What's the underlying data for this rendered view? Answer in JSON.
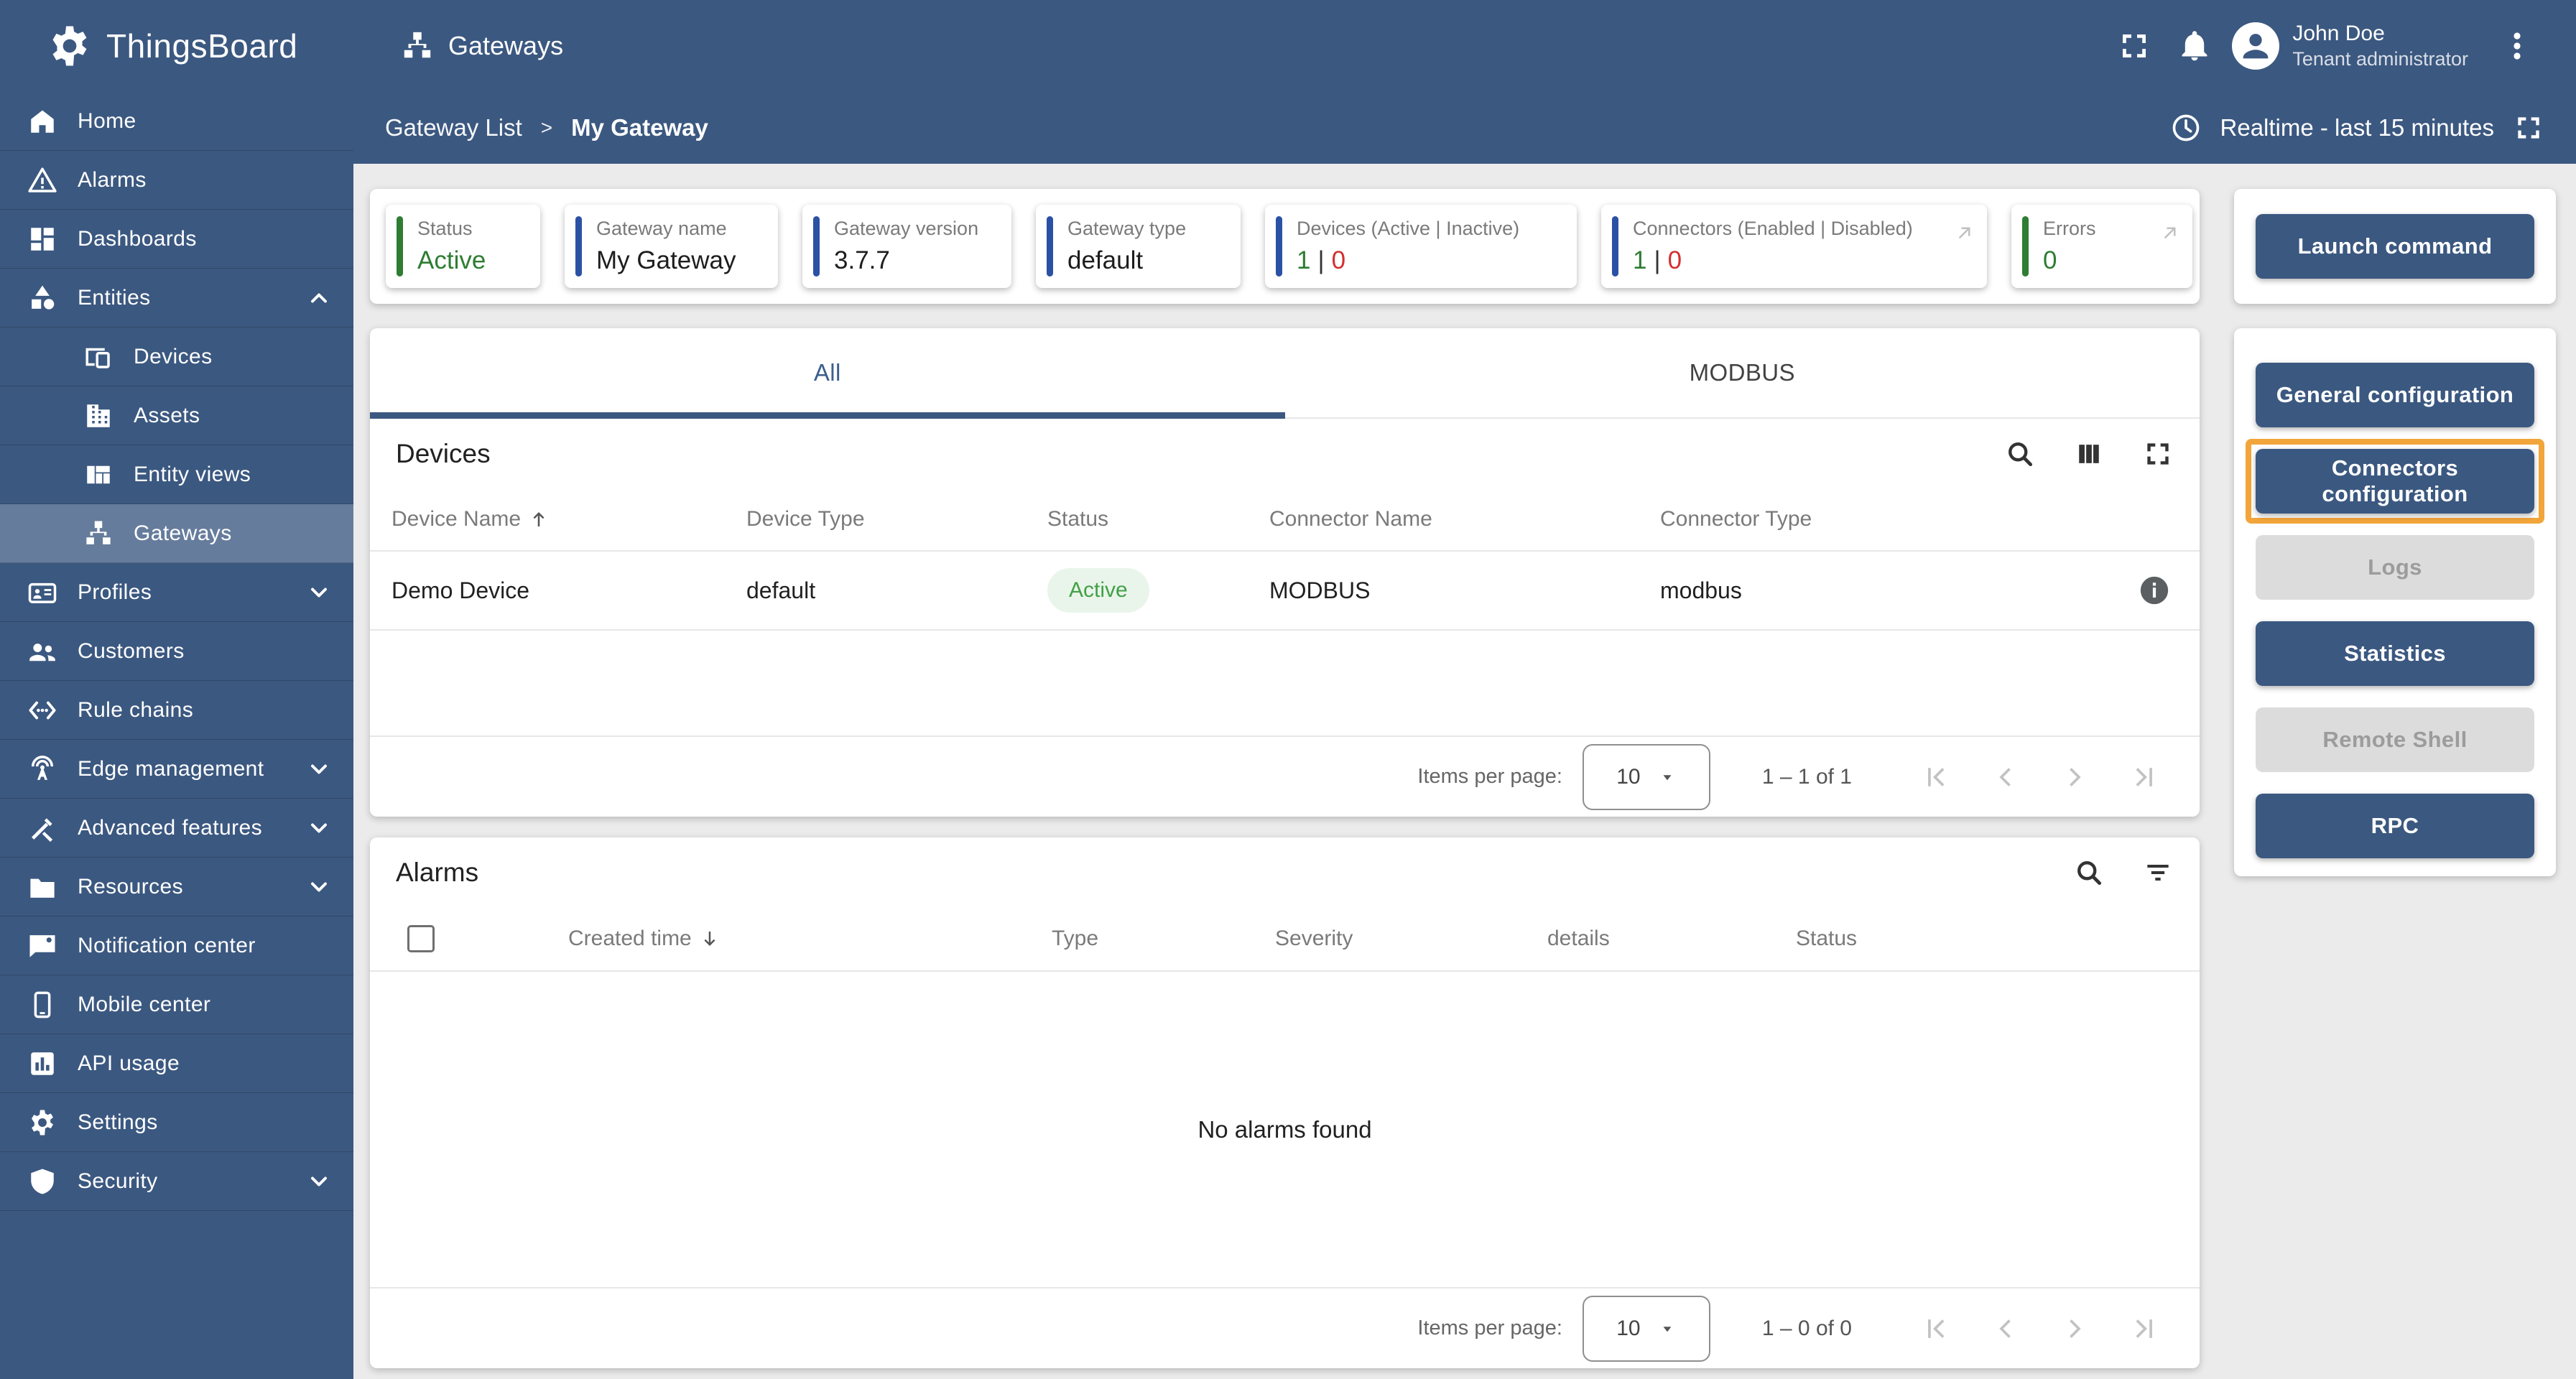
{
  "topbar": {
    "brand": "ThingsBoard",
    "page_title": "Gateways",
    "user": {
      "name": "John Doe",
      "role": "Tenant administrator"
    }
  },
  "breadcrumb": {
    "parent": "Gateway List",
    "separator": ">",
    "current": "My Gateway"
  },
  "time_window": {
    "label": "Realtime - last 15 minutes"
  },
  "sidebar": {
    "items": [
      {
        "label": "Home"
      },
      {
        "label": "Alarms"
      },
      {
        "label": "Dashboards"
      },
      {
        "label": "Entities",
        "expanded": true,
        "children": [
          {
            "label": "Devices"
          },
          {
            "label": "Assets"
          },
          {
            "label": "Entity views"
          },
          {
            "label": "Gateways",
            "selected": true
          }
        ]
      },
      {
        "label": "Profiles"
      },
      {
        "label": "Customers"
      },
      {
        "label": "Rule chains"
      },
      {
        "label": "Edge management"
      },
      {
        "label": "Advanced features"
      },
      {
        "label": "Resources"
      },
      {
        "label": "Notification center"
      },
      {
        "label": "Mobile center"
      },
      {
        "label": "API usage"
      },
      {
        "label": "Settings"
      },
      {
        "label": "Security"
      }
    ]
  },
  "stats": {
    "status": {
      "label": "Status",
      "value": "Active"
    },
    "gateway_name": {
      "label": "Gateway name",
      "value": "My Gateway"
    },
    "gateway_version": {
      "label": "Gateway version",
      "value": "3.7.7"
    },
    "gateway_type": {
      "label": "Gateway type",
      "value": "default"
    },
    "devices": {
      "label": "Devices (Active | Inactive)",
      "value_active": "1",
      "value_divider": "|",
      "value_inactive": "0"
    },
    "connectors": {
      "label": "Connectors (Enabled | Disabled)",
      "value_enabled": "1",
      "value_divider": "|",
      "value_disabled": "0"
    },
    "errors": {
      "label": "Errors",
      "value": "0"
    }
  },
  "tabs": {
    "all": "All",
    "modbus": "MODBUS"
  },
  "devices_panel": {
    "title": "Devices",
    "columns": {
      "name": "Device Name",
      "type": "Device Type",
      "status": "Status",
      "connector_name": "Connector Name",
      "connector_type": "Connector Type"
    },
    "rows": [
      {
        "name": "Demo Device",
        "type": "default",
        "status": "Active",
        "connector_name": "MODBUS",
        "connector_type": "modbus"
      }
    ],
    "pagination": {
      "items_per_page_label": "Items per page:",
      "page_size": "10",
      "range": "1 – 1 of 1"
    }
  },
  "alarms_panel": {
    "title": "Alarms",
    "columns": {
      "created_time": "Created time",
      "type": "Type",
      "severity": "Severity",
      "details": "details",
      "status": "Status"
    },
    "empty_message": "No alarms found",
    "pagination": {
      "items_per_page_label": "Items per page:",
      "page_size": "10",
      "range": "1 – 0 of 0"
    }
  },
  "actions_panel": {
    "launch": "Launch command",
    "buttons": [
      {
        "label": "General configuration",
        "enabled": true
      },
      {
        "label": "Connectors configuration",
        "enabled": true,
        "highlighted": true
      },
      {
        "label": "Logs",
        "enabled": false
      },
      {
        "label": "Statistics",
        "enabled": true
      },
      {
        "label": "Remote Shell",
        "enabled": false
      },
      {
        "label": "RPC",
        "enabled": true
      }
    ]
  },
  "colors": {
    "primary": "#3b5880",
    "accent_blue": "#2b51a5",
    "accent_green": "#2e7d32",
    "accent_red": "#d32f2f",
    "highlight_orange": "#f2a53a",
    "status_pill_bg": "#e9f5ea",
    "status_pill_text": "#43a047"
  }
}
